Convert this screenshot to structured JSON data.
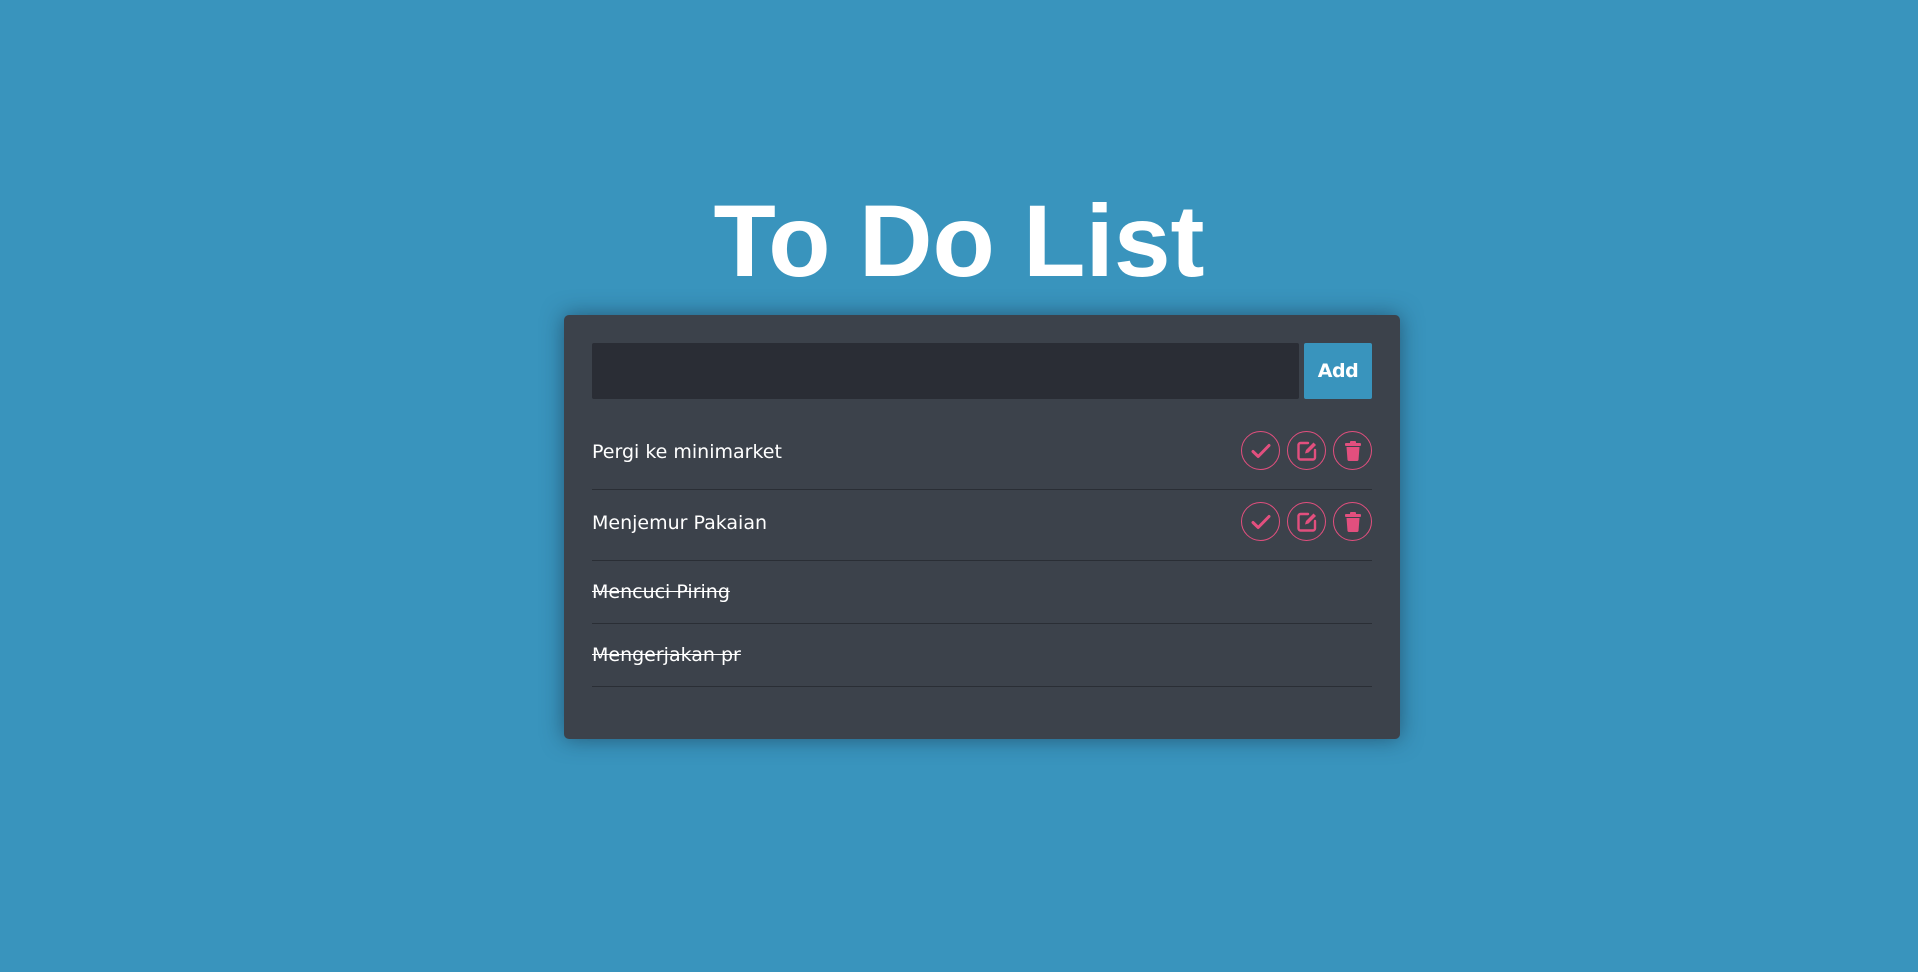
{
  "title": "To Do List",
  "input": {
    "value": "",
    "placeholder": ""
  },
  "add_button_label": "Add",
  "colors": {
    "background": "#3994bd",
    "card": "#3c424b",
    "input": "#2a2d35",
    "accent": "#e24f7e"
  },
  "tasks": [
    {
      "text": "Pergi ke minimarket",
      "completed": false,
      "actions": [
        "check-icon",
        "edit-icon",
        "trash-icon"
      ]
    },
    {
      "text": "Menjemur Pakaian",
      "completed": false,
      "actions": [
        "check-icon",
        "edit-icon",
        "trash-icon"
      ]
    },
    {
      "text": "Mencuci Piring",
      "completed": true
    },
    {
      "text": "Mengerjakan pr",
      "completed": true
    }
  ]
}
